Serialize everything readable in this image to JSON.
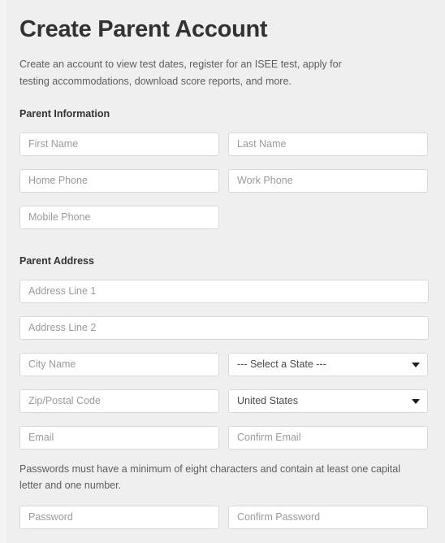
{
  "header": {
    "title": "Create Parent Account",
    "description": "Create an account to view test dates, register for an ISEE test, apply for testing accommodations, download score reports, and more."
  },
  "sections": {
    "parent_information": {
      "heading": "Parent Information",
      "fields": {
        "first_name": {
          "placeholder": "First Name",
          "value": ""
        },
        "last_name": {
          "placeholder": "Last Name",
          "value": ""
        },
        "home_phone": {
          "placeholder": "Home Phone",
          "value": ""
        },
        "work_phone": {
          "placeholder": "Work Phone",
          "value": ""
        },
        "mobile_phone": {
          "placeholder": "Mobile Phone",
          "value": ""
        }
      }
    },
    "parent_address": {
      "heading": "Parent Address",
      "fields": {
        "address_line_1": {
          "placeholder": "Address Line 1",
          "value": ""
        },
        "address_line_2": {
          "placeholder": "Address Line 2",
          "value": ""
        },
        "city": {
          "placeholder": "City Name",
          "value": ""
        },
        "state": {
          "selected": "--- Select a State ---"
        },
        "zip": {
          "placeholder": "Zip/Postal Code",
          "value": ""
        },
        "country": {
          "selected": "United States"
        },
        "email": {
          "placeholder": "Email",
          "value": ""
        },
        "confirm_email": {
          "placeholder": "Confirm Email",
          "value": ""
        },
        "password": {
          "placeholder": "Password",
          "value": ""
        },
        "confirm_password": {
          "placeholder": "Confirm Password",
          "value": ""
        }
      },
      "password_hint": "Passwords must have a minimum of eight characters and contain at least one capital letter and one number."
    }
  },
  "icons": {
    "state_caret": "chevron-down-icon",
    "country_caret": "chevron-down-icon"
  },
  "colors": {
    "page_background": "#efefef",
    "field_background": "#ffffff",
    "field_border": "#d8d8d8",
    "title_text": "#323232",
    "body_text": "#5d5d5d",
    "placeholder_text": "#9a9a9a",
    "select_text": "#4a4a4a"
  }
}
